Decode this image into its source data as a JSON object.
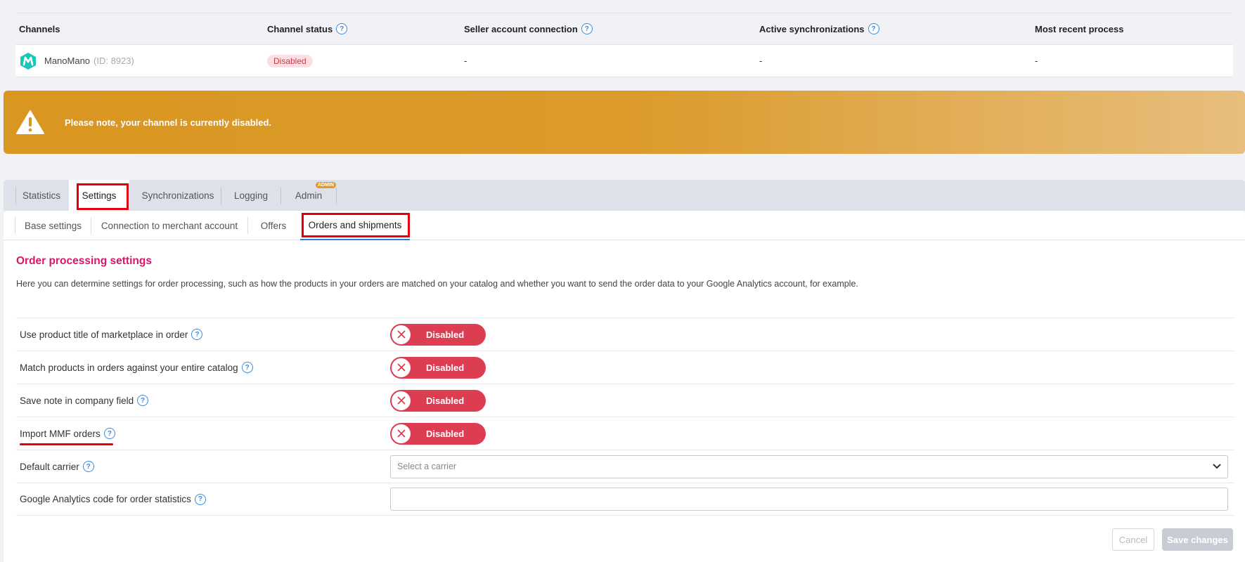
{
  "channels_table": {
    "headers": {
      "channels": "Channels",
      "channel_status": "Channel status",
      "seller_account_connection": "Seller account connection",
      "active_synchronizations": "Active synchronizations",
      "most_recent_process": "Most recent process"
    },
    "row": {
      "name": "ManoMano",
      "id": "(ID: 8923)",
      "status": "Disabled",
      "seller_account_connection": "-",
      "active_synchronizations": "-",
      "most_recent_process": "-"
    }
  },
  "warning": {
    "text": "Please note, your channel is currently disabled.",
    "icon": "warning-triangle-icon",
    "color": "#d99620"
  },
  "tabs": {
    "statistics": "Statistics",
    "settings": "Settings",
    "synchronizations": "Synchronizations",
    "logging": "Logging",
    "admin": "Admin",
    "admin_badge": "ADMIN",
    "active": "Settings"
  },
  "subtabs": {
    "base_settings": "Base settings",
    "connection": "Connection to merchant account",
    "offers": "Offers",
    "orders": "Orders and shipments",
    "active": "Orders and shipments"
  },
  "section": {
    "title": "Order processing settings",
    "description": "Here you can determine settings for order processing, such as how the products in your orders are matched on your catalog and whether you want to send the order data to your Google Analytics account, for example."
  },
  "settings": [
    {
      "label": "Use product title of marketplace in order",
      "value": "Disabled"
    },
    {
      "label": "Match products in orders against your entire catalog",
      "value": "Disabled"
    },
    {
      "label": "Save note in company field",
      "value": "Disabled"
    },
    {
      "label": "Import MMF orders",
      "value": "Disabled"
    },
    {
      "label": "Default carrier",
      "placeholder": "Select a carrier"
    },
    {
      "label": "Google Analytics code for order statistics",
      "value": ""
    }
  ],
  "buttons": {
    "cancel": "Cancel",
    "save": "Save changes"
  },
  "colors": {
    "accent_pink": "#d8166b",
    "toggle_disabled": "#dc3d50",
    "help_blue": "#3a8be0",
    "highlight_red": "#e0000d"
  }
}
